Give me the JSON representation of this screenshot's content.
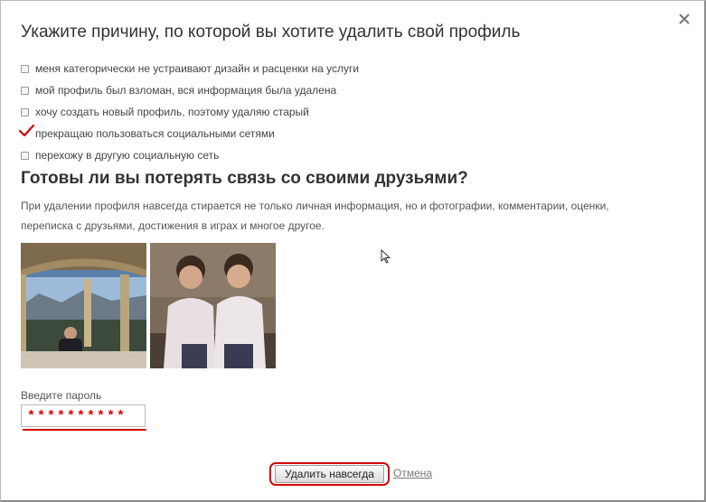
{
  "dialog": {
    "title": "Укажите причину, по которой вы хотите удалить свой профиль",
    "close_icon": "close-icon"
  },
  "reasons": [
    {
      "label": "меня категорически не устраивают дизайн и расценки на услуги",
      "checked": false
    },
    {
      "label": "мой профиль был взломан, вся информация была удалена",
      "checked": false
    },
    {
      "label": "хочу создать новый профиль, поэтому удаляю старый",
      "checked": false
    },
    {
      "label": "прекращаю пользоваться социальными сетями",
      "checked": true
    },
    {
      "label": "перехожу в другую социальную сеть",
      "checked": false
    }
  ],
  "friends": {
    "heading": "Готовы ли вы потерять связь со своими друзьями?",
    "description": "При удалении профиля навсегда стирается не только личная информация, но и фотографии, комментарии, оценки, переписка с друзьями, достижения в играх и многое другое."
  },
  "password": {
    "label": "Введите пароль",
    "value": "**********"
  },
  "actions": {
    "delete_label": "Удалить навсегда",
    "cancel_label": "Отмена"
  },
  "colors": {
    "annotation": "#d40000",
    "link": "#777777"
  }
}
